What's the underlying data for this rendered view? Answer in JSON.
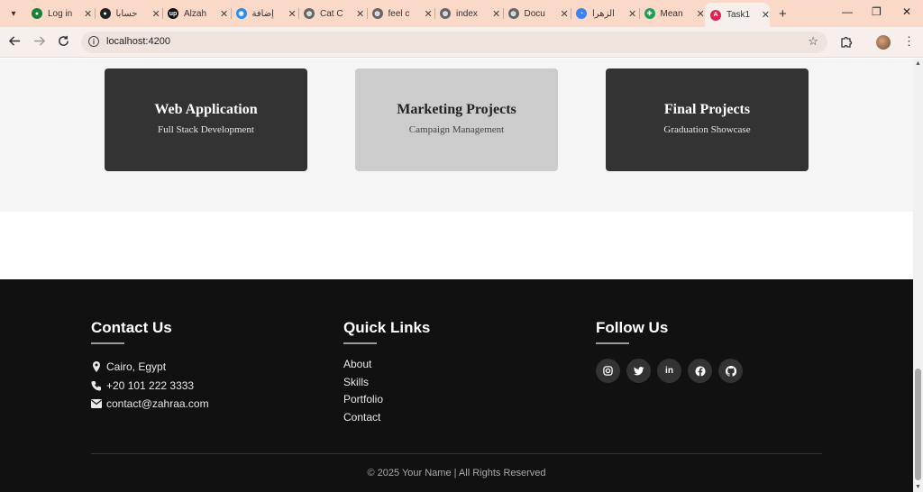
{
  "browser": {
    "tabs": [
      {
        "title": "Log in",
        "favicon_color": "#1a7f37",
        "favicon_glyph": "●"
      },
      {
        "title": "حسابا",
        "favicon_color": "#222222",
        "favicon_glyph": "●"
      },
      {
        "title": "Alzah",
        "favicon_color": "#111111",
        "favicon_glyph": "up"
      },
      {
        "title": "إضافة",
        "favicon_color": "#2b8be8",
        "favicon_glyph": "◉"
      },
      {
        "title": "Cat C",
        "favicon_color": "#666666",
        "favicon_glyph": "◍"
      },
      {
        "title": "feel c",
        "favicon_color": "#666666",
        "favicon_glyph": "◍"
      },
      {
        "title": "index",
        "favicon_color": "#666666",
        "favicon_glyph": "◍"
      },
      {
        "title": "Docu",
        "favicon_color": "#666666",
        "favicon_glyph": "◍"
      },
      {
        "title": "الزهرا",
        "favicon_color": "#3b82f6",
        "favicon_glyph": "◔"
      },
      {
        "title": "Mean",
        "favicon_color": "#1e9e55",
        "favicon_glyph": "✚"
      },
      {
        "title": "Task1",
        "favicon_color": "#dd2254",
        "favicon_glyph": "A",
        "active": true
      }
    ],
    "close_glyph": "✕",
    "new_tab_glyph": "+",
    "window_controls": {
      "minimize": "—",
      "restore": "❐",
      "close": "✕"
    },
    "address": {
      "url": "localhost:4200"
    },
    "icons": {
      "back": "arrow-left-icon",
      "forward": "arrow-right-icon",
      "reload": "reload-icon",
      "info": "info-icon",
      "bookmark": "star-icon",
      "extensions": "puzzle-icon",
      "profile": "profile-avatar",
      "menu": "kebab-menu-icon"
    }
  },
  "portfolio": {
    "cards": [
      {
        "title": "Web Application",
        "subtitle": "Full Stack Development",
        "style": "dark"
      },
      {
        "title": "Marketing Projects",
        "subtitle": "Campaign Management",
        "style": "light"
      },
      {
        "title": "Final Projects",
        "subtitle": "Graduation Showcase",
        "style": "dark"
      }
    ]
  },
  "footer": {
    "contact": {
      "heading": "Contact Us",
      "items": [
        {
          "icon": "location-pin-icon",
          "text": "Cairo, Egypt"
        },
        {
          "icon": "phone-icon",
          "text": "+20 101 222 3333"
        },
        {
          "icon": "envelope-icon",
          "text": "contact@zahraa.com"
        }
      ]
    },
    "quick_links": {
      "heading": "Quick Links",
      "items": [
        "About",
        "Skills",
        "Portfolio",
        "Contact"
      ]
    },
    "follow": {
      "heading": "Follow Us",
      "socials": [
        {
          "name": "instagram-icon",
          "glyph": "◙"
        },
        {
          "name": "twitter-icon",
          "glyph": "🐦"
        },
        {
          "name": "linkedin-icon",
          "glyph": "in"
        },
        {
          "name": "facebook-icon",
          "glyph": "f"
        },
        {
          "name": "github-icon",
          "glyph": "◕"
        }
      ]
    },
    "copyright": "© 2025 Your Name | All Rights Reserved"
  },
  "colors": {
    "tabbar": "#fbd9c9",
    "footer_bg": "#111111",
    "card_dark": "#333333",
    "card_light": "#cccccc",
    "section_bg": "#f5f5f5"
  }
}
